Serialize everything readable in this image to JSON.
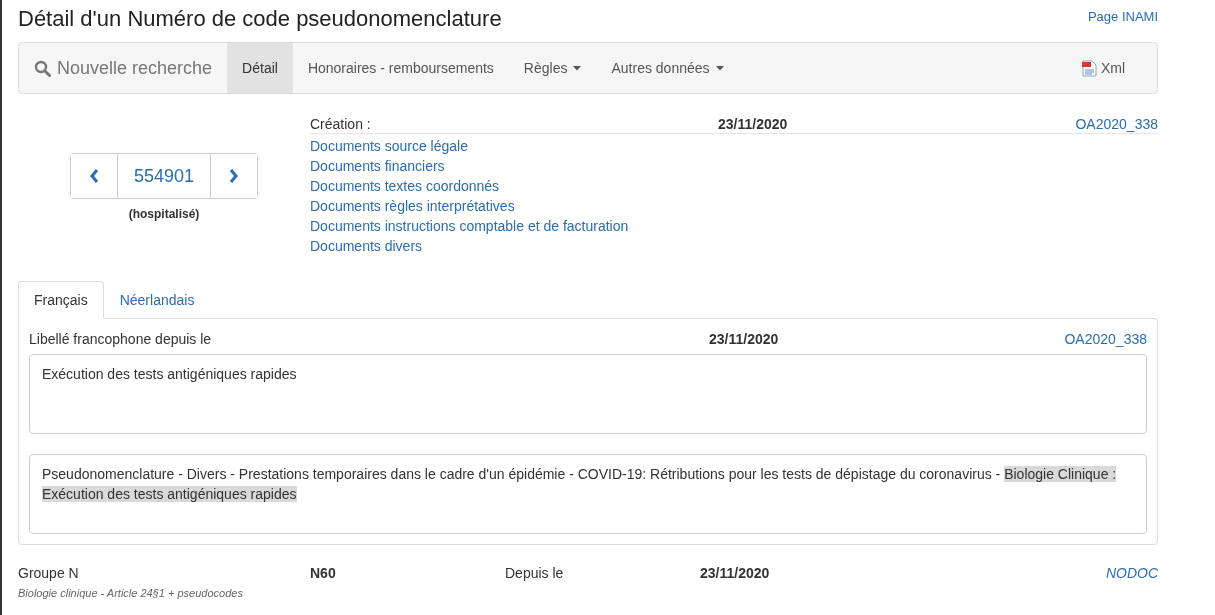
{
  "title": "Détail d'un Numéro de code pseudonomenclature",
  "header_link": "Page INAMI",
  "nav": [
    {
      "kind": "search",
      "label": "Nouvelle recherche",
      "selected": false
    },
    {
      "kind": "link",
      "label": "Détail",
      "selected": true
    },
    {
      "kind": "link",
      "label": "Honoraires - remboursements",
      "selected": false
    },
    {
      "kind": "dropdown",
      "label": "Règles",
      "selected": false
    },
    {
      "kind": "dropdown",
      "label": "Autres données",
      "selected": false
    },
    {
      "kind": "xml",
      "label": "Xml",
      "selected": false
    }
  ],
  "pager": {
    "code": "554901",
    "note": "(hospitalisé)"
  },
  "creation": {
    "label": "Création :",
    "date": "23/11/2020",
    "reference": "OA2020_338"
  },
  "documents": [
    "Documents source légale",
    "Documents financiers",
    "Documents textes coordonnés",
    "Documents règles interprétatives",
    "Documents instructions comptable et de facturation",
    "Documents divers"
  ],
  "tabs": [
    {
      "label": "Français",
      "selected": true
    },
    {
      "label": "Néerlandais",
      "selected": false
    }
  ],
  "label_row": {
    "label": "Libellé francophone depuis le",
    "date": "23/11/2020",
    "reference": "OA2020_338"
  },
  "short_text": "Exécution des tests antigéniques rapides",
  "long_text": {
    "text": "Pseudonomenclature - Divers - Prestations temporaires dans le cadre d'un épidémie - COVID-19: Rétributions pour les tests de dépistage du coronavirus - ",
    "highlight": "Biologie Clinique : Exécution des tests antigéniques rapides"
  },
  "group": {
    "label": "Groupe N",
    "code": "N60",
    "since_label": "Depuis le",
    "date": "23/11/2020",
    "reference": "NODOC",
    "description": "Biologie clinique - Article 24§1 + pseudocodes"
  }
}
